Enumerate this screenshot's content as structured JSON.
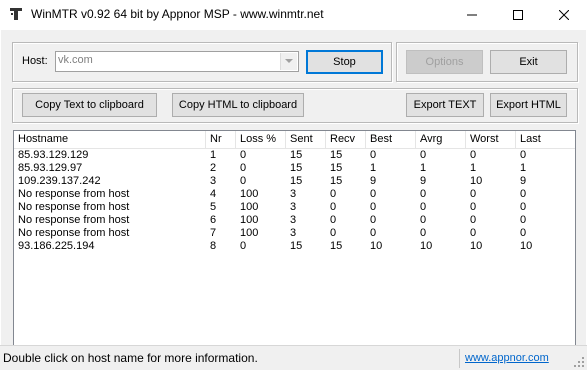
{
  "window": {
    "title": "WinMTR v0.92 64 bit by Appnor MSP - www.winmtr.net",
    "controls": [
      "minimize",
      "maximize",
      "close"
    ]
  },
  "host": {
    "label": "Host:",
    "value": "vk.com"
  },
  "buttons": {
    "stop": "Stop",
    "options": "Options",
    "exit": "Exit",
    "copy_text": "Copy Text to clipboard",
    "copy_html": "Copy HTML to clipboard",
    "export_text": "Export TEXT",
    "export_html": "Export HTML"
  },
  "table": {
    "columns": [
      "Hostname",
      "Nr",
      "Loss %",
      "Sent",
      "Recv",
      "Best",
      "Avrg",
      "Worst",
      "Last"
    ],
    "rows": [
      [
        "85.93.129.129",
        "1",
        "0",
        "15",
        "15",
        "0",
        "0",
        "0",
        "0"
      ],
      [
        "85.93.129.97",
        "2",
        "0",
        "15",
        "15",
        "1",
        "1",
        "1",
        "1"
      ],
      [
        "109.239.137.242",
        "3",
        "0",
        "15",
        "15",
        "9",
        "9",
        "10",
        "9"
      ],
      [
        "No response from host",
        "4",
        "100",
        "3",
        "0",
        "0",
        "0",
        "0",
        "0"
      ],
      [
        "No response from host",
        "5",
        "100",
        "3",
        "0",
        "0",
        "0",
        "0",
        "0"
      ],
      [
        "No response from host",
        "6",
        "100",
        "3",
        "0",
        "0",
        "0",
        "0",
        "0"
      ],
      [
        "No response from host",
        "7",
        "100",
        "3",
        "0",
        "0",
        "0",
        "0",
        "0"
      ],
      [
        "93.186.225.194",
        "8",
        "0",
        "15",
        "15",
        "10",
        "10",
        "10",
        "10"
      ]
    ]
  },
  "status": {
    "message": "Double click on host name for more information.",
    "link": "www.appnor.com"
  },
  "colors": {
    "link": "#0066cc",
    "default_button_border": "#0078d7",
    "disabled_text": "#a0a0a0"
  }
}
